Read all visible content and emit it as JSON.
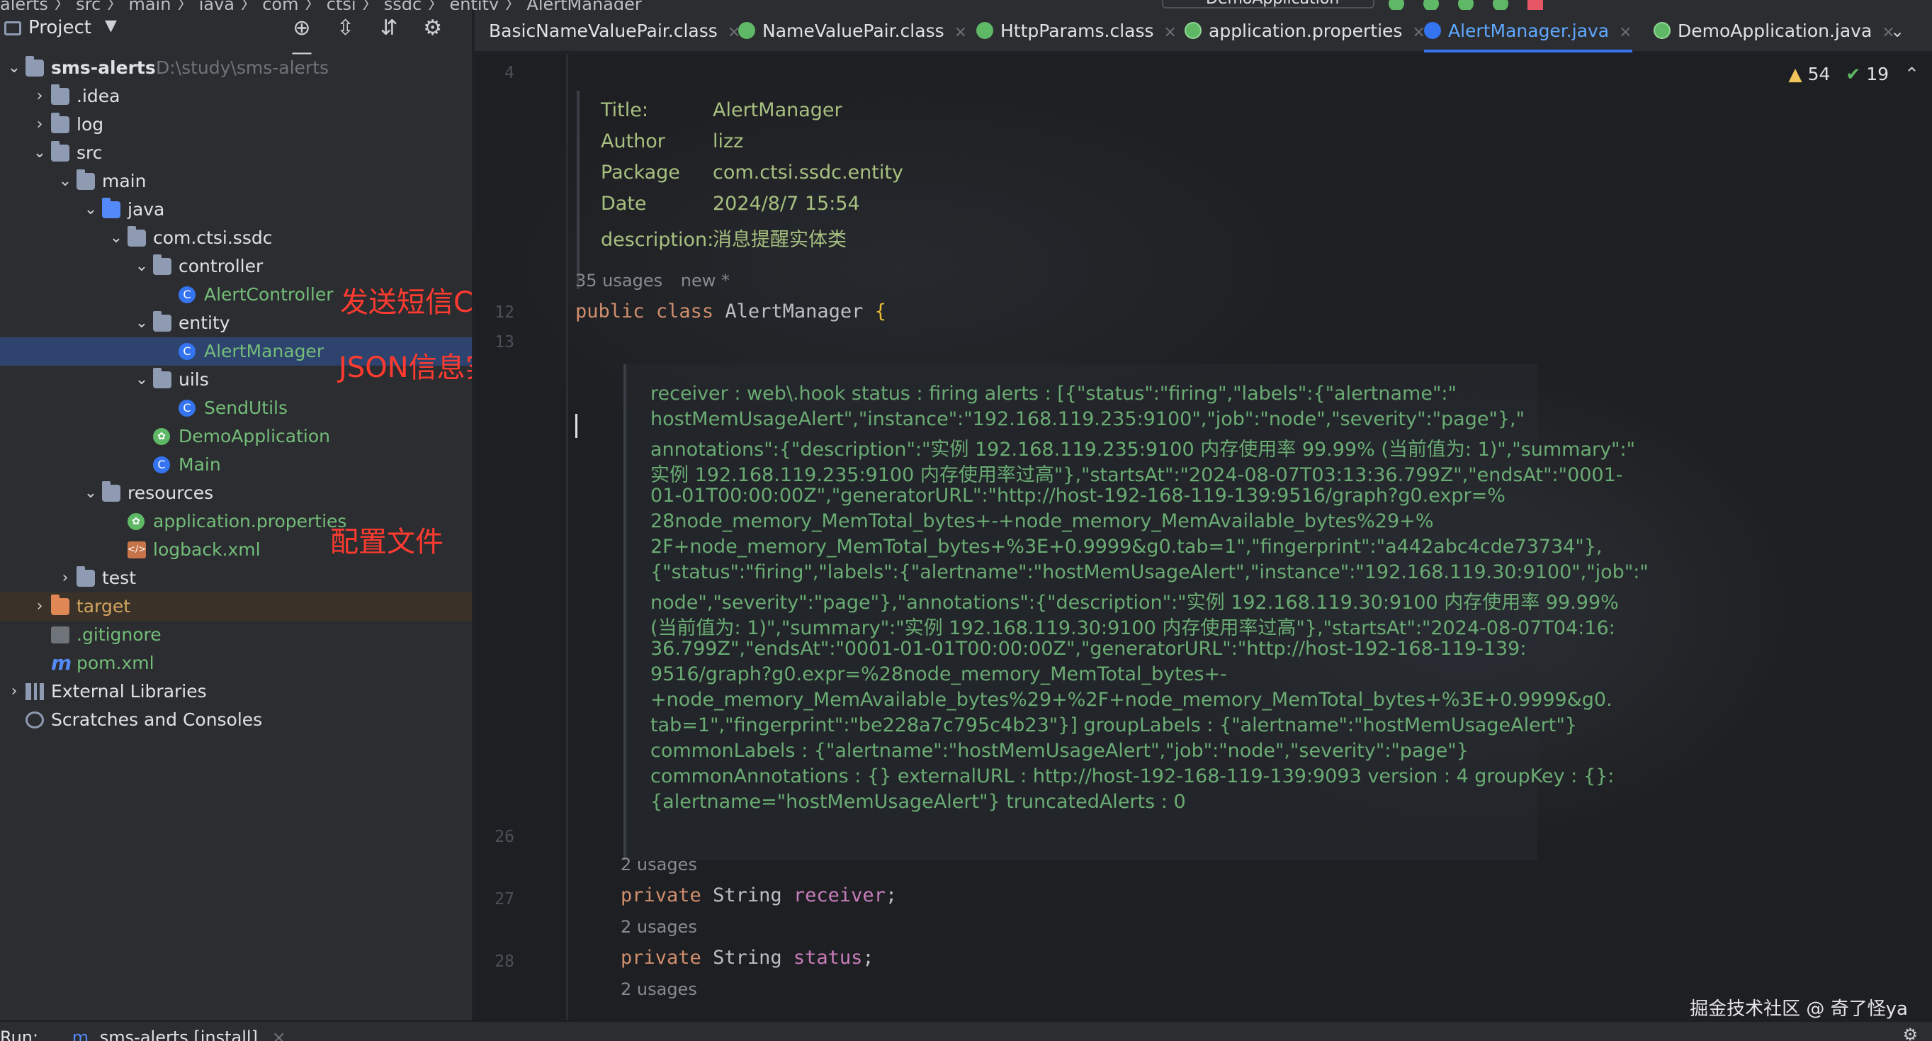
{
  "breadcrumbs": "alerts 〉 src 〉 main 〉 java 〉 com 〉 ctsi 〉 ssdc 〉 entity 〉 AlertManager",
  "run_config": "DemoApplication",
  "project_panel": {
    "title": "Project",
    "tree": [
      {
        "label": "sms-alerts",
        "hint": "D:\\study\\sms-alerts",
        "depth": 0,
        "icon": "module-folder-icon",
        "expanded": true,
        "color": "default"
      },
      {
        "label": ".idea",
        "depth": 1,
        "icon": "folder-icon",
        "expanded": false,
        "color": "default"
      },
      {
        "label": "log",
        "depth": 1,
        "icon": "folder-icon",
        "expanded": false,
        "color": "default"
      },
      {
        "label": "src",
        "depth": 1,
        "icon": "folder-icon",
        "expanded": true,
        "color": "default"
      },
      {
        "label": "main",
        "depth": 2,
        "icon": "folder-icon",
        "expanded": true,
        "color": "default"
      },
      {
        "label": "java",
        "depth": 3,
        "icon": "source-folder-icon",
        "expanded": true,
        "color": "default"
      },
      {
        "label": "com.ctsi.ssdc",
        "depth": 4,
        "icon": "package-icon",
        "expanded": true,
        "color": "default"
      },
      {
        "label": "controller",
        "depth": 5,
        "icon": "package-icon",
        "expanded": true,
        "color": "default"
      },
      {
        "label": "AlertController",
        "depth": 6,
        "icon": "class-icon",
        "color": "green"
      },
      {
        "label": "entity",
        "depth": 5,
        "icon": "package-icon",
        "expanded": true,
        "color": "default"
      },
      {
        "label": "AlertManager",
        "depth": 6,
        "icon": "class-icon",
        "color": "green",
        "selected": true
      },
      {
        "label": "uils",
        "depth": 5,
        "icon": "package-icon",
        "expanded": true,
        "color": "default"
      },
      {
        "label": "SendUtils",
        "depth": 6,
        "icon": "class-icon",
        "color": "green"
      },
      {
        "label": "DemoApplication",
        "depth": 5,
        "icon": "spring-class-icon",
        "color": "green"
      },
      {
        "label": "Main",
        "depth": 5,
        "icon": "class-icon",
        "color": "green"
      },
      {
        "label": "resources",
        "depth": 3,
        "icon": "resources-folder-icon",
        "expanded": true,
        "color": "default"
      },
      {
        "label": "application.properties",
        "depth": 4,
        "icon": "spring-properties-icon",
        "color": "green"
      },
      {
        "label": "logback.xml",
        "depth": 4,
        "icon": "xml-icon",
        "color": "green"
      },
      {
        "label": "test",
        "depth": 2,
        "icon": "folder-icon",
        "expanded": false,
        "color": "default"
      },
      {
        "label": "target",
        "depth": 1,
        "icon": "excluded-folder-icon",
        "expanded": false,
        "color": "orange",
        "target": true
      },
      {
        "label": ".gitignore",
        "depth": 1,
        "icon": "gitignore-icon",
        "color": "green"
      },
      {
        "label": "pom.xml",
        "depth": 1,
        "icon": "maven-icon",
        "color": "green"
      },
      {
        "label": "External Libraries",
        "depth": 0,
        "icon": "library-icon",
        "expanded": false,
        "color": "default"
      },
      {
        "label": "Scratches and Consoles",
        "depth": 0,
        "icon": "scratch-icon",
        "color": "default"
      }
    ],
    "annotations": {
      "controller": "发送短信Controller",
      "entity": "JSON信息实体类",
      "config": "配置文件"
    }
  },
  "tabs": [
    {
      "label": "BasicNameValuePair.class",
      "icon": "none",
      "active": false
    },
    {
      "label": "NameValuePair.class",
      "icon": "interface-icon",
      "active": false
    },
    {
      "label": "HttpParams.class",
      "icon": "interface-icon",
      "active": false
    },
    {
      "label": "application.properties",
      "icon": "spring-properties-icon",
      "active": false
    },
    {
      "label": "AlertManager.java",
      "icon": "class-icon",
      "active": true
    },
    {
      "label": "DemoApplication.java",
      "icon": "spring-class-icon",
      "active": false
    }
  ],
  "inspections": {
    "warnings": "54",
    "ok": "19"
  },
  "editor": {
    "line_numbers": {
      "l4": "4",
      "l12": "12",
      "l13": "13",
      "l26": "26",
      "l27": "27",
      "l28": "28"
    },
    "doc": [
      {
        "key": "Title:",
        "value": "AlertManager"
      },
      {
        "key": "Author",
        "value": "lizz"
      },
      {
        "key": "Package",
        "value": "com.ctsi.ssdc.entity"
      },
      {
        "key": "Date",
        "value": "2024/8/7 15:54"
      },
      {
        "key": "description:",
        "value": "消息提醒实体类"
      }
    ],
    "class_usages": "35 usages",
    "class_new": "new *",
    "class_decl": {
      "kw1": "public",
      "kw2": "class",
      "name": "AlertManager",
      "brace": "{"
    },
    "comment_lines": [
      "receiver : web\\.hook status : firing alerts : [{\"status\":\"firing\",\"labels\":{\"alertname\":\"",
      "hostMemUsageAlert\",\"instance\":\"192.168.119.235:9100\",\"job\":\"node\",\"severity\":\"page\"},\"",
      "annotations\":{\"description\":\"实例 192.168.119.235:9100 内存使用率 99.99% (当前值为: 1)\",\"summary\":\"",
      "实例 192.168.119.235:9100 内存使用率过高\"},\"startsAt\":\"2024-08-07T03:13:36.799Z\",\"endsAt\":\"0001-",
      "01-01T00:00:00Z\",\"generatorURL\":\"http://host-192-168-119-139:9516/graph?g0.expr=%",
      "28node_memory_MemTotal_bytes+-+node_memory_MemAvailable_bytes%29+%",
      "2F+node_memory_MemTotal_bytes+%3E+0.9999&g0.tab=1\",\"fingerprint\":\"a442abc4cde73734\"},",
      "{\"status\":\"firing\",\"labels\":{\"alertname\":\"hostMemUsageAlert\",\"instance\":\"192.168.119.30:9100\",\"job\":\"",
      "node\",\"severity\":\"page\"},\"annotations\":{\"description\":\"实例 192.168.119.30:9100 内存使用率 99.99%",
      "(当前值为: 1)\",\"summary\":\"实例 192.168.119.30:9100 内存使用率过高\"},\"startsAt\":\"2024-08-07T04:16:",
      "36.799Z\",\"endsAt\":\"0001-01-01T00:00:00Z\",\"generatorURL\":\"http://host-192-168-119-139:",
      "9516/graph?g0.expr=%28node_memory_MemTotal_bytes+-",
      "+node_memory_MemAvailable_bytes%29+%2F+node_memory_MemTotal_bytes+%3E+0.9999&g0.",
      "tab=1\",\"fingerprint\":\"be228a7c795c4b23\"}] groupLabels : {\"alertname\":\"hostMemUsageAlert\"}",
      "commonLabels : {\"alertname\":\"hostMemUsageAlert\",\"job\":\"node\",\"severity\":\"page\"}",
      "commonAnnotations : {} externalURL : http://host-192-168-119-139:9093 version : 4 groupKey : {}:",
      "{alertname=\"hostMemUsageAlert\"} truncatedAlerts : 0"
    ],
    "fields": [
      {
        "usages": "2 usages",
        "kw": "private",
        "type": "String",
        "name": "receiver",
        "end": ";"
      },
      {
        "usages": "2 usages",
        "kw": "private",
        "type": "String",
        "name": "status",
        "end": ";"
      }
    ],
    "last_usages": "2 usages"
  },
  "watermark": "掘金技术社区 @ 奇了怪ya",
  "bottom": {
    "run_label": "Run:",
    "run_config": "sms-alerts [install]"
  },
  "colors": {
    "accent": "#3574f0",
    "annotation": "#ff3b30",
    "comment": "#6aab73",
    "keyword": "#cf8e6d"
  }
}
